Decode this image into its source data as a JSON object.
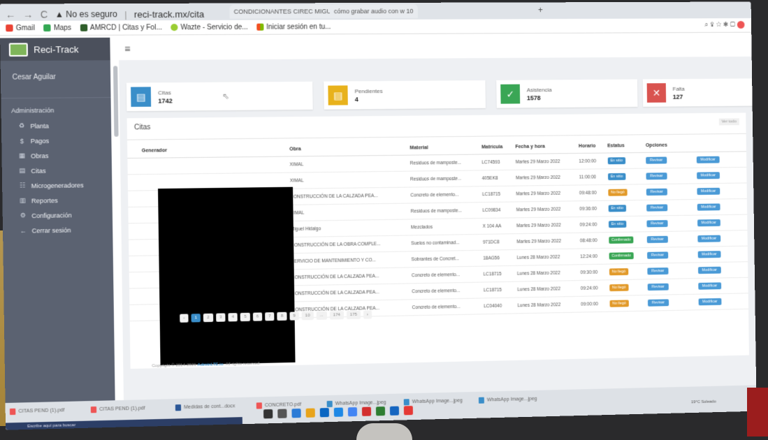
{
  "browser": {
    "tabs": [
      "CONDICIONANTES CIREC MIGU",
      "cómo grabar audio con w 10",
      "+"
    ],
    "address": "reci-track.mx/cita",
    "insecure_label": "No es seguro",
    "bookmarks": [
      "Gmail",
      "Maps",
      "AMRCD | Citas y Fol...",
      "Wazte - Servicio de...",
      "Iniciar sesión en tu..."
    ]
  },
  "app": {
    "brand": "Reci-Track",
    "user": "Cesar Aguilar",
    "section": "Administración",
    "menu": [
      {
        "icon": "♻",
        "label": "Planta"
      },
      {
        "icon": "$",
        "label": "Pagos"
      },
      {
        "icon": "▦",
        "label": "Obras"
      },
      {
        "icon": "▤",
        "label": "Citas"
      },
      {
        "icon": "☷",
        "label": "Microgeneradores"
      },
      {
        "icon": "▥",
        "label": "Reportes"
      },
      {
        "icon": "⚙",
        "label": "Configuración"
      },
      {
        "icon": "←",
        "label": "Cerrar sesión"
      }
    ],
    "menu_toggle": "≡"
  },
  "cards": [
    {
      "label": "Citas",
      "value": "1742",
      "color": "#3a8ec9"
    },
    {
      "label": "Pendientes",
      "value": "4",
      "color": "#e8b21c"
    },
    {
      "label": "Asistencia",
      "value": "1578",
      "color": "#3aa655"
    },
    {
      "label": "Falta",
      "value": "127",
      "color": "#d9534f"
    }
  ],
  "panel": {
    "title": "Citas",
    "more": "Ver todo"
  },
  "table": {
    "headers": [
      "Generador",
      "Obra",
      "Material",
      "Matrícula",
      "Fecha y hora",
      "Horario",
      "Estatus",
      "Opciones"
    ],
    "rows": [
      {
        "obra": "XIMAL",
        "material": "Residuos de mamposte...",
        "matricula": "LC74593",
        "fecha": "Martes 29 Marzo 2022",
        "horario": "12:00:00",
        "estatus": "En sitio",
        "ec": "b-blue"
      },
      {
        "obra": "XIMAL",
        "material": "Residuos de mamposte...",
        "matricula": "405EK8",
        "fecha": "Martes 29 Marzo 2022",
        "horario": "11:00:00",
        "estatus": "En sitio",
        "ec": "b-blue"
      },
      {
        "obra": "CONSTRUCCIÓN DE LA CALZADA PEA...",
        "material": "Concreto de elemento...",
        "matricula": "LC18715",
        "fecha": "Martes 29 Marzo 2022",
        "horario": "09:48:00",
        "estatus": "No llegó",
        "ec": "b-orange"
      },
      {
        "obra": "XIMAL",
        "material": "Residuos de mamposte...",
        "matricula": "LC09834",
        "fecha": "Martes 29 Marzo 2022",
        "horario": "09:36:00",
        "estatus": "En sitio",
        "ec": "b-blue"
      },
      {
        "obra": "Miguel Hidalgo",
        "material": "Mezclados",
        "matricula": "X 104 AA",
        "fecha": "Martes 29 Marzo 2022",
        "horario": "09:24:00",
        "estatus": "En sitio",
        "ec": "b-blue"
      },
      {
        "obra": "CONSTRUCCIÓN DE LA OBRA COMPLE...",
        "material": "Suelos no contaminad...",
        "matricula": "971DC8",
        "fecha": "Martes 29 Marzo 2022",
        "horario": "08:48:00",
        "estatus": "Confirmado",
        "ec": "b-green"
      },
      {
        "obra": "SERVICIO DE MANTENIMIENTO Y CO...",
        "material": "Sobrantes de Concret...",
        "matricula": "18AG56",
        "fecha": "Lunes 28 Marzo 2022",
        "horario": "12:24:00",
        "estatus": "Confirmado",
        "ec": "b-green"
      },
      {
        "obra": "CONSTRUCCIÓN DE LA CALZADA PEA...",
        "material": "Concreto de elemento...",
        "matricula": "LC18715",
        "fecha": "Lunes 28 Marzo 2022",
        "horario": "09:30:00",
        "estatus": "No llegó",
        "ec": "b-orange"
      },
      {
        "obra": "CONSTRUCCIÓN DE LA CALZADA PEA...",
        "material": "Concreto de elemento...",
        "matricula": "LC18715",
        "fecha": "Lunes 28 Marzo 2022",
        "horario": "09:24:00",
        "estatus": "No llegó",
        "ec": "b-orange"
      },
      {
        "obra": "CONSTRUCCIÓN DE LA CALZADA PEA...",
        "material": "Concreto de elemento...",
        "matricula": "LC04040",
        "fecha": "Lunes 28 Marzo 2022",
        "horario": "09:00:00",
        "estatus": "No llegó",
        "ec": "b-orange"
      }
    ],
    "btn_view": "Revisar",
    "btn_edit": "Modificar"
  },
  "pager": [
    "‹",
    "1",
    "2",
    "3",
    "4",
    "5",
    "6",
    "7",
    "8",
    "9",
    "10",
    "...",
    "174",
    "175",
    "›"
  ],
  "footer": {
    "prefix": "Copyright © 2014-2021",
    "brand": "AdminLTE.io",
    "suffix": ". All rights reserved."
  },
  "taskbar": {
    "downloads": [
      "CITAS PEND (1).pdf",
      "CITAS PEND (1).pdf",
      "Medidas de cont...docx",
      "CONCRETO.pdf",
      "WhatsApp Image...jpeg",
      "WhatsApp Image...jpeg",
      "WhatsApp Image...jpeg"
    ],
    "search": "Escribe aquí para buscar",
    "system": "19°C Soleado"
  }
}
